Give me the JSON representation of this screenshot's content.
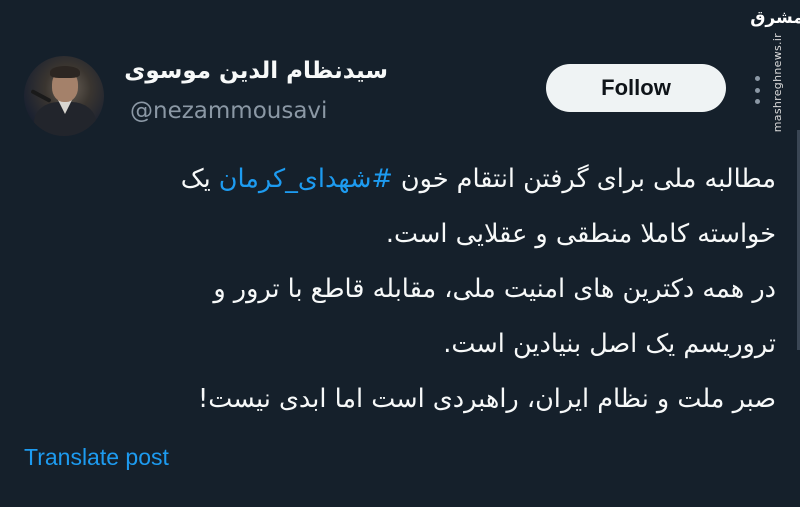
{
  "watermark": {
    "logo": "مشرق",
    "url": "mashreghnews.ir"
  },
  "author": {
    "display_name": "سیدنظام الدین موسوی",
    "handle": "@nezammousavi",
    "avatar_icon": "profile-photo"
  },
  "follow_label": "Follow",
  "more_icon": "more-options-icon",
  "tweet": {
    "line1_prefix": "مطالبه ملی برای گرفتن انتقام خون ",
    "hashtag": "#شهدای_کرمان",
    "line1_suffix": " یک",
    "line2": "خواسته کاملا منطقی و عقلایی است.",
    "line3": "در همه دکترین های امنیت ملی، مقابله قاطع با ترور و",
    "line4": "تروریسم یک اصل بنیادین است.",
    "line5": "صبر ملت و نظام ایران، راهبردی است اما ابدی نیست!"
  },
  "translate_label": "Translate post",
  "colors": {
    "background": "#15202b",
    "text": "#f7f9f9",
    "secondary": "#8b98a5",
    "accent": "#1d9bf0",
    "button": "#eff3f4"
  }
}
